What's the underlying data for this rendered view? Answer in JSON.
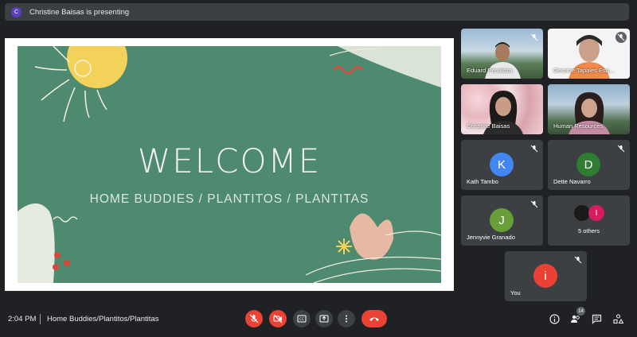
{
  "presenter_bar": {
    "avatar_letter": "C",
    "text": "Christine Baisas is presenting"
  },
  "slide": {
    "title": "WELCOME",
    "subtitle": "HOME BUDDIES / PLANTITOS / PLANTITAS",
    "colors": {
      "background": "#4d8a6f",
      "text": "#f3f3ee"
    }
  },
  "participants": [
    {
      "name": "Eduard Penaloza",
      "type": "video"
    },
    {
      "name": "Gerome Tapales Esq...",
      "type": "video"
    },
    {
      "name": "Christine Baisas",
      "type": "video"
    },
    {
      "name": "Human Resources",
      "type": "video"
    },
    {
      "name": "Kath Tambo",
      "letter": "K",
      "color": "#4285f4",
      "type": "avatar"
    },
    {
      "name": "Dette Navarro",
      "letter": "D",
      "color": "#2e7d32",
      "type": "avatar"
    },
    {
      "name": "Jennyvie Granado",
      "letter": "J",
      "color": "#689f38",
      "type": "avatar"
    },
    {
      "name": "5 others",
      "letter": "I",
      "color": "#d81b60",
      "type": "group"
    },
    {
      "name": "You",
      "letter": "i",
      "color": "#e94235",
      "type": "avatar"
    }
  ],
  "bottombar": {
    "time": "2:04 PM",
    "meeting_name": "Home Buddies/Plantitos/Plantitas",
    "participant_count": "14",
    "icons": [
      "mic-off-icon",
      "camera-off-icon",
      "captions-icon",
      "present-icon",
      "more-icon",
      "end-call-icon",
      "info-icon",
      "people-icon",
      "chat-icon",
      "activities-icon"
    ]
  }
}
